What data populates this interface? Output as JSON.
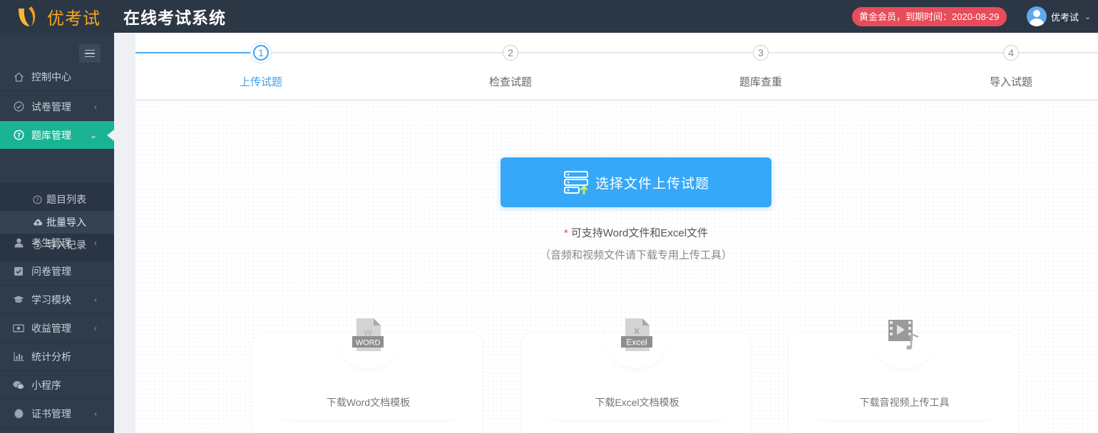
{
  "header": {
    "logo_text": "优考试",
    "system_title": "在线考试系统",
    "member_badge": "黄金会员，到期时间：2020-08-29",
    "user_name": "优考试"
  },
  "sidebar": {
    "items": [
      {
        "label": "控制中心",
        "icon": "home-icon"
      },
      {
        "label": "试卷管理",
        "icon": "check-circle-icon",
        "has_arrow": true
      },
      {
        "label": "题库管理",
        "icon": "question-circle-icon",
        "active": true,
        "expanded": true
      },
      {
        "label": "考生管理",
        "icon": "user-icon",
        "has_arrow": true
      },
      {
        "label": "问卷管理",
        "icon": "checkbox-icon"
      },
      {
        "label": "学习模块",
        "icon": "graduation-cap-icon",
        "has_arrow": true
      },
      {
        "label": "收益管理",
        "icon": "money-icon",
        "has_arrow": true
      },
      {
        "label": "统计分析",
        "icon": "bar-chart-icon"
      },
      {
        "label": "小程序",
        "icon": "wechat-icon"
      },
      {
        "label": "证书管理",
        "icon": "certificate-icon",
        "has_arrow": true
      }
    ],
    "sub_items": [
      {
        "label": "题目列表",
        "icon": "question-circle-icon"
      },
      {
        "label": "批量导入",
        "icon": "cloud-upload-icon",
        "current": true
      },
      {
        "label": "导入记录",
        "icon": "history-icon"
      }
    ]
  },
  "steps": [
    {
      "number": "1",
      "label": "上传试题",
      "active": true
    },
    {
      "number": "2",
      "label": "检查试题"
    },
    {
      "number": "3",
      "label": "题库查重"
    },
    {
      "number": "4",
      "label": "导入试题"
    }
  ],
  "upload": {
    "button_label": "选择文件上传试题",
    "required_mark": "*",
    "support_text": "可支持Word文件和Excel文件",
    "sub_text": "（音频和视频文件请下载专用上传工具）"
  },
  "downloads": [
    {
      "label": "下载Word文档模板",
      "icon": "word-file-icon",
      "badge": "WORD"
    },
    {
      "label": "下载Excel文档模板",
      "icon": "excel-file-icon",
      "badge": "Excel"
    },
    {
      "label": "下载音视频上传工具",
      "icon": "video-file-icon"
    }
  ],
  "colors": {
    "topbar": "#2c3745",
    "sidebar": "#2f3c4b",
    "active_menu": "#1ab394",
    "primary": "#36a8f7",
    "badge": "#e84c5a",
    "logo": "#f5a623"
  }
}
